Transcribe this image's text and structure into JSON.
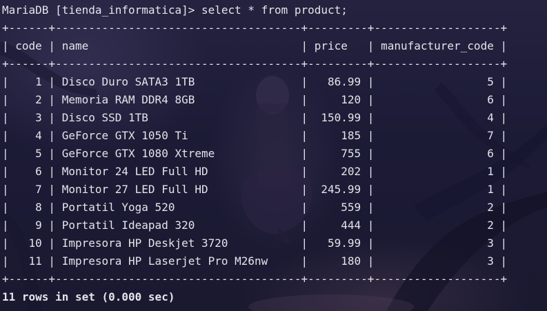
{
  "prompt": "MariaDB [tienda_informatica]>",
  "command": "select * from product;",
  "table": {
    "border": "+------+-------------------------------------+---------+-------------------+",
    "header_row": "| code | name                                | price   | manufacturer_code |",
    "rows": [
      "|    1 | Disco Duro SATA3 1TB                |   86.99 |                 5 |",
      "|    2 | Memoria RAM DDR4 8GB                |     120 |                 6 |",
      "|    3 | Disco SSD 1TB                       |  150.99 |                 4 |",
      "|    4 | GeForce GTX 1050 Ti                 |     185 |                 7 |",
      "|    5 | GeForce GTX 1080 Xtreme             |     755 |                 6 |",
      "|    6 | Monitor 24 LED Full HD              |     202 |                 1 |",
      "|    7 | Monitor 27 LED Full HD              |  245.99 |                 1 |",
      "|    8 | Portatil Yoga 520                   |     559 |                 2 |",
      "|    9 | Portatil Ideapad 320                |     444 |                 2 |",
      "|   10 | Impresora HP Deskjet 3720           |   59.99 |                 3 |",
      "|   11 | Impresora HP Laserjet Pro M26nw     |     180 |                 3 |"
    ]
  },
  "summary": "11 rows in set (0.000 sec)",
  "colors": {
    "background": "#1b1a33",
    "text": "#e4e4ea"
  }
}
